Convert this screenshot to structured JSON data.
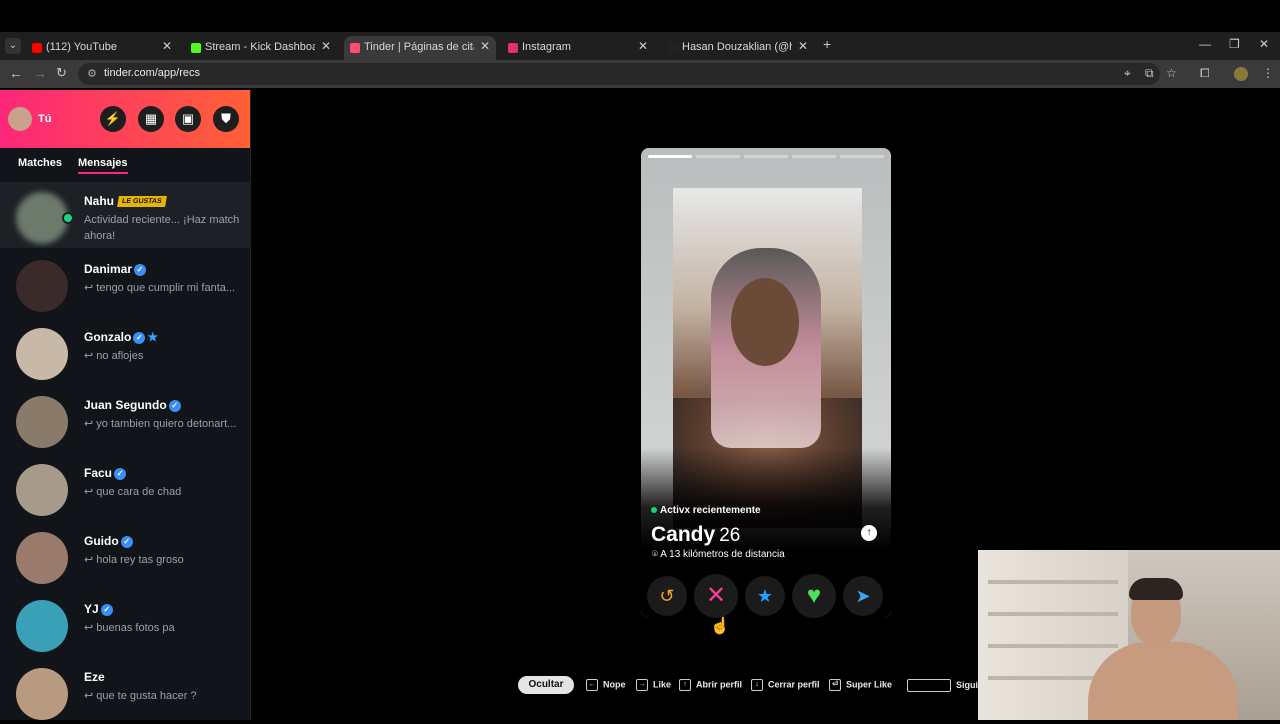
{
  "browser": {
    "tabs": [
      {
        "title": "(112) YouTube",
        "favicon_color": "#ff0000",
        "active": false
      },
      {
        "title": "Stream - Kick Dashboard",
        "favicon_color": "#53fc18",
        "active": false
      },
      {
        "title": "Tinder | Páginas de citas",
        "favicon_color": "#fd5068",
        "active": true
      },
      {
        "title": "Instagram",
        "favicon_color": "#e1306c",
        "active": false
      },
      {
        "title": "Hasan Douzaklian (@hasan.do",
        "favicon_color": "#222222",
        "active": false
      }
    ],
    "url": "tinder.com/app/recs"
  },
  "sidebar": {
    "me_label": "Tú",
    "tabs": [
      "Matches",
      "Mensajes"
    ],
    "active_tab": "Mensajes",
    "messages": [
      {
        "name": "Nahu",
        "badge": "LE GUSTAS",
        "preview": "Actividad reciente... ¡Haz match ahora!",
        "verified": false,
        "online": true,
        "highlight": true,
        "avatar_color": "#6b7a6a"
      },
      {
        "name": "Danimar",
        "preview": "↩ tengo que cumplir mi fanta...",
        "verified": true,
        "avatar_color": "#3a2a2a"
      },
      {
        "name": "Gonzalo",
        "preview": "↩ no aflojes",
        "verified": true,
        "super": true,
        "avatar_color": "#c8b8a8"
      },
      {
        "name": "Juan Segundo",
        "preview": "↩ yo tambien quiero detonart...",
        "verified": true,
        "avatar_color": "#8a7a6a"
      },
      {
        "name": "Facu",
        "preview": "↩ que cara de chad",
        "verified": true,
        "avatar_color": "#a89a8a"
      },
      {
        "name": "Guido",
        "preview": "↩ hola rey tas groso",
        "verified": true,
        "avatar_color": "#9a7a6a"
      },
      {
        "name": "YJ",
        "preview": "↩ buenas fotos pa",
        "verified": true,
        "avatar_color": "#3aa0b8"
      },
      {
        "name": "Eze",
        "preview": "↩ que te gusta hacer ?",
        "verified": false,
        "avatar_color": "#b89a80"
      }
    ]
  },
  "card": {
    "photo_count": 5,
    "current_photo": 1,
    "status": "Activx recientemente",
    "name": "Candy",
    "age": "26",
    "distance": "A 13 kilómetros de distancia",
    "actions": [
      {
        "name": "rewind",
        "icon": "↺",
        "color": "#f5a623"
      },
      {
        "name": "nope",
        "icon": "✕",
        "color": "#fd3f93"
      },
      {
        "name": "super-like",
        "icon": "★",
        "color": "#1ea0ff"
      },
      {
        "name": "like",
        "icon": "♥",
        "color": "#4ee05a"
      },
      {
        "name": "boost",
        "icon": "➤",
        "color": "#3aa6f5"
      }
    ]
  },
  "shortcuts": {
    "hide": "Ocultar",
    "items": [
      {
        "key": "←",
        "label": "Nope"
      },
      {
        "key": "→",
        "label": "Like"
      },
      {
        "key": "↑",
        "label": "Abrir perfil"
      },
      {
        "key": "↓",
        "label": "Cerrar perfil"
      },
      {
        "key": "⏎",
        "label": "Super Like"
      },
      {
        "key": "",
        "label": "Siguie"
      }
    ]
  }
}
